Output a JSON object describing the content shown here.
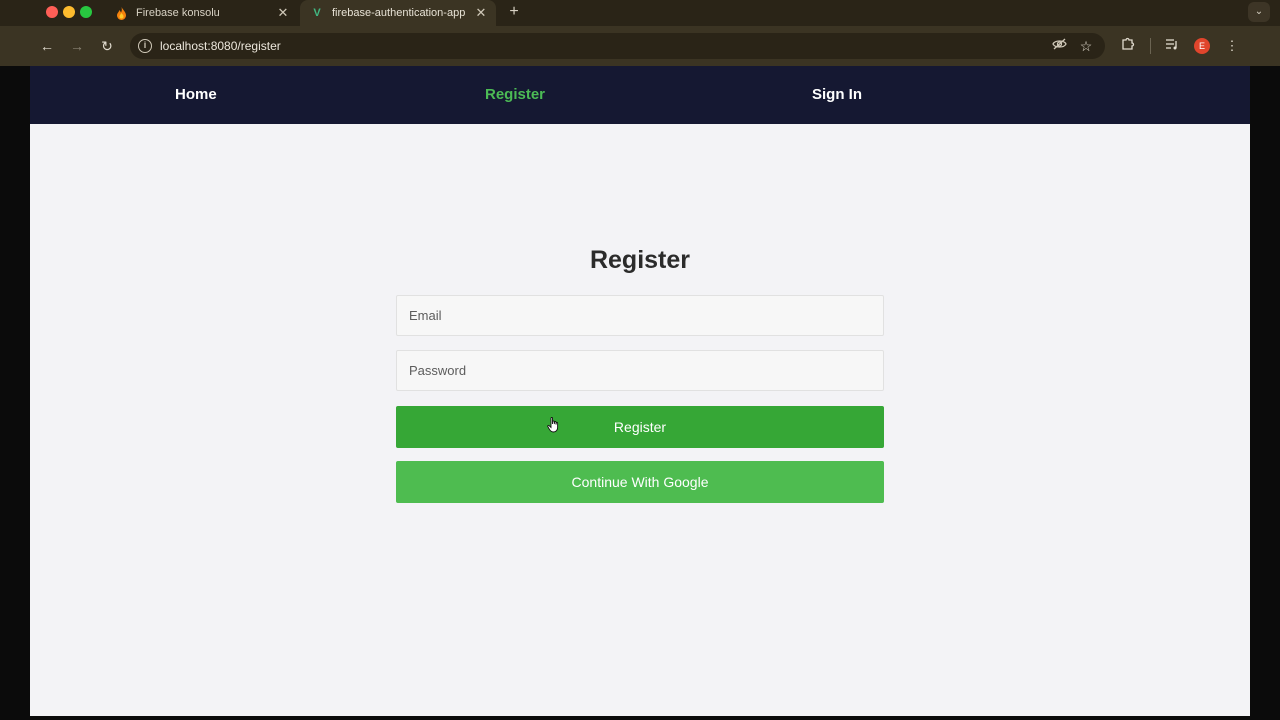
{
  "browser": {
    "tabs": [
      {
        "title": "Firebase konsolu",
        "active": false,
        "favicon": "firebase-flame-icon"
      },
      {
        "title": "firebase-authentication-app",
        "active": true,
        "favicon": "vue-logo-icon"
      }
    ],
    "tab_favicon_vue": "V",
    "address": "localhost:8080/register",
    "profile_initial": "E"
  },
  "nav": {
    "home": "Home",
    "register": "Register",
    "sign_in": "Sign In"
  },
  "form": {
    "title": "Register",
    "email_placeholder": "Email",
    "password_placeholder": "Password",
    "register_button": "Register",
    "google_button": "Continue With Google"
  },
  "colors": {
    "nav_bg": "#151832",
    "nav_active": "#4cbb55",
    "register_button": "#36a736",
    "google_button": "#4ebc50",
    "page_bg": "#f3f3f6"
  }
}
